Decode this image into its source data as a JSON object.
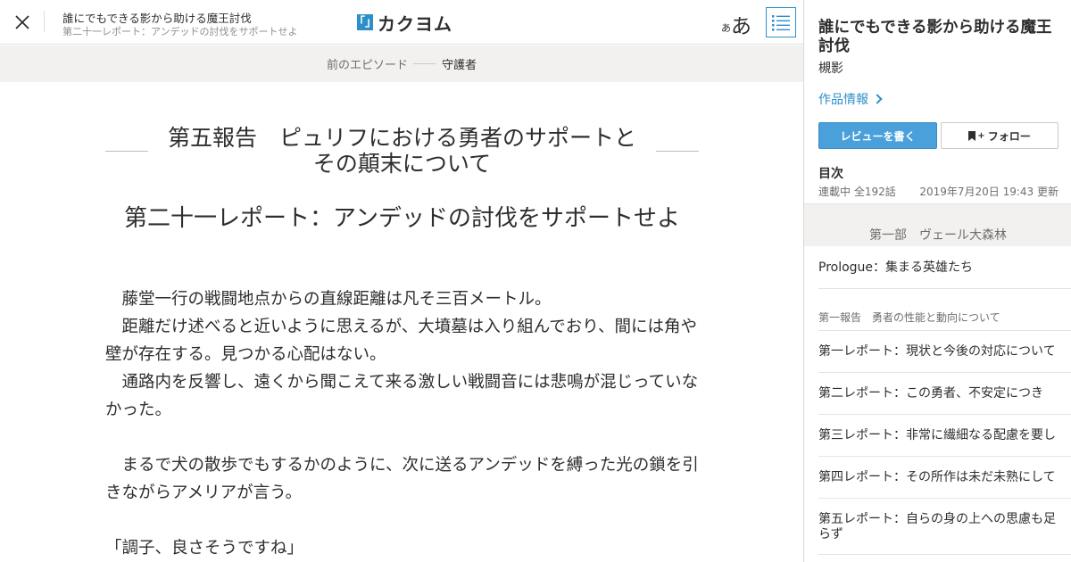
{
  "header": {
    "work_title": "誰にでもできる影から助ける魔王討伐",
    "episode_subtitle": "第二十一レポート：アンデッドの討伐をサポートせよ",
    "logo_mark": "「」",
    "logo_text": "カクヨム",
    "font_small": "あ",
    "font_large": "あ"
  },
  "prev_episode": {
    "label": "前のエピソード",
    "title": "守護者"
  },
  "main": {
    "chapter_line1": "第五報告　ピュリフにおける勇者のサポートと",
    "chapter_line2": "その顛末について",
    "episode_title": "第二十一レポート：アンデッドの討伐をサポートせよ",
    "paragraphs": [
      "　藤堂一行の戦闘地点からの直線距離は凡そ三百メートル。",
      "　距離だけ述べると近いように思えるが、大墳墓は入り組んでおり、間には角や壁が存在する。見つかる心配はない。",
      "　通路内を反響し、遠くから聞こえて来る激しい戦闘音には悲鳴が混じっていなかった。",
      "",
      "　まるで犬の散歩でもするかのように、次に送るアンデッドを縛った光の鎖を引きながらアメリアが言う。",
      "",
      "「調子、良さそうですね」"
    ]
  },
  "panel": {
    "title": "誰にでもできる影から助ける魔王討伐",
    "author": "槻影",
    "work_info": "作品情報",
    "review_button": "レビューを書く",
    "follow_button": "フォロー",
    "toc_label": "目次",
    "status": "連載中 全192話",
    "updated": "2019年7月20日 19:43 更新",
    "part_title": "第一部　ヴェール大森林",
    "prologue": "Prologue：集まる英雄たち",
    "section1": "第一報告　勇者の性能と動向について",
    "episodes": [
      "第一レポート：現状と今後の対応について",
      "第二レポート：この勇者、不安定につき",
      "第三レポート：非常に繊細なる配慮を要し",
      "第四レポート：その所作は未だ未熟にして",
      "第五レポート：自らの身の上への思慮も足らず"
    ]
  }
}
